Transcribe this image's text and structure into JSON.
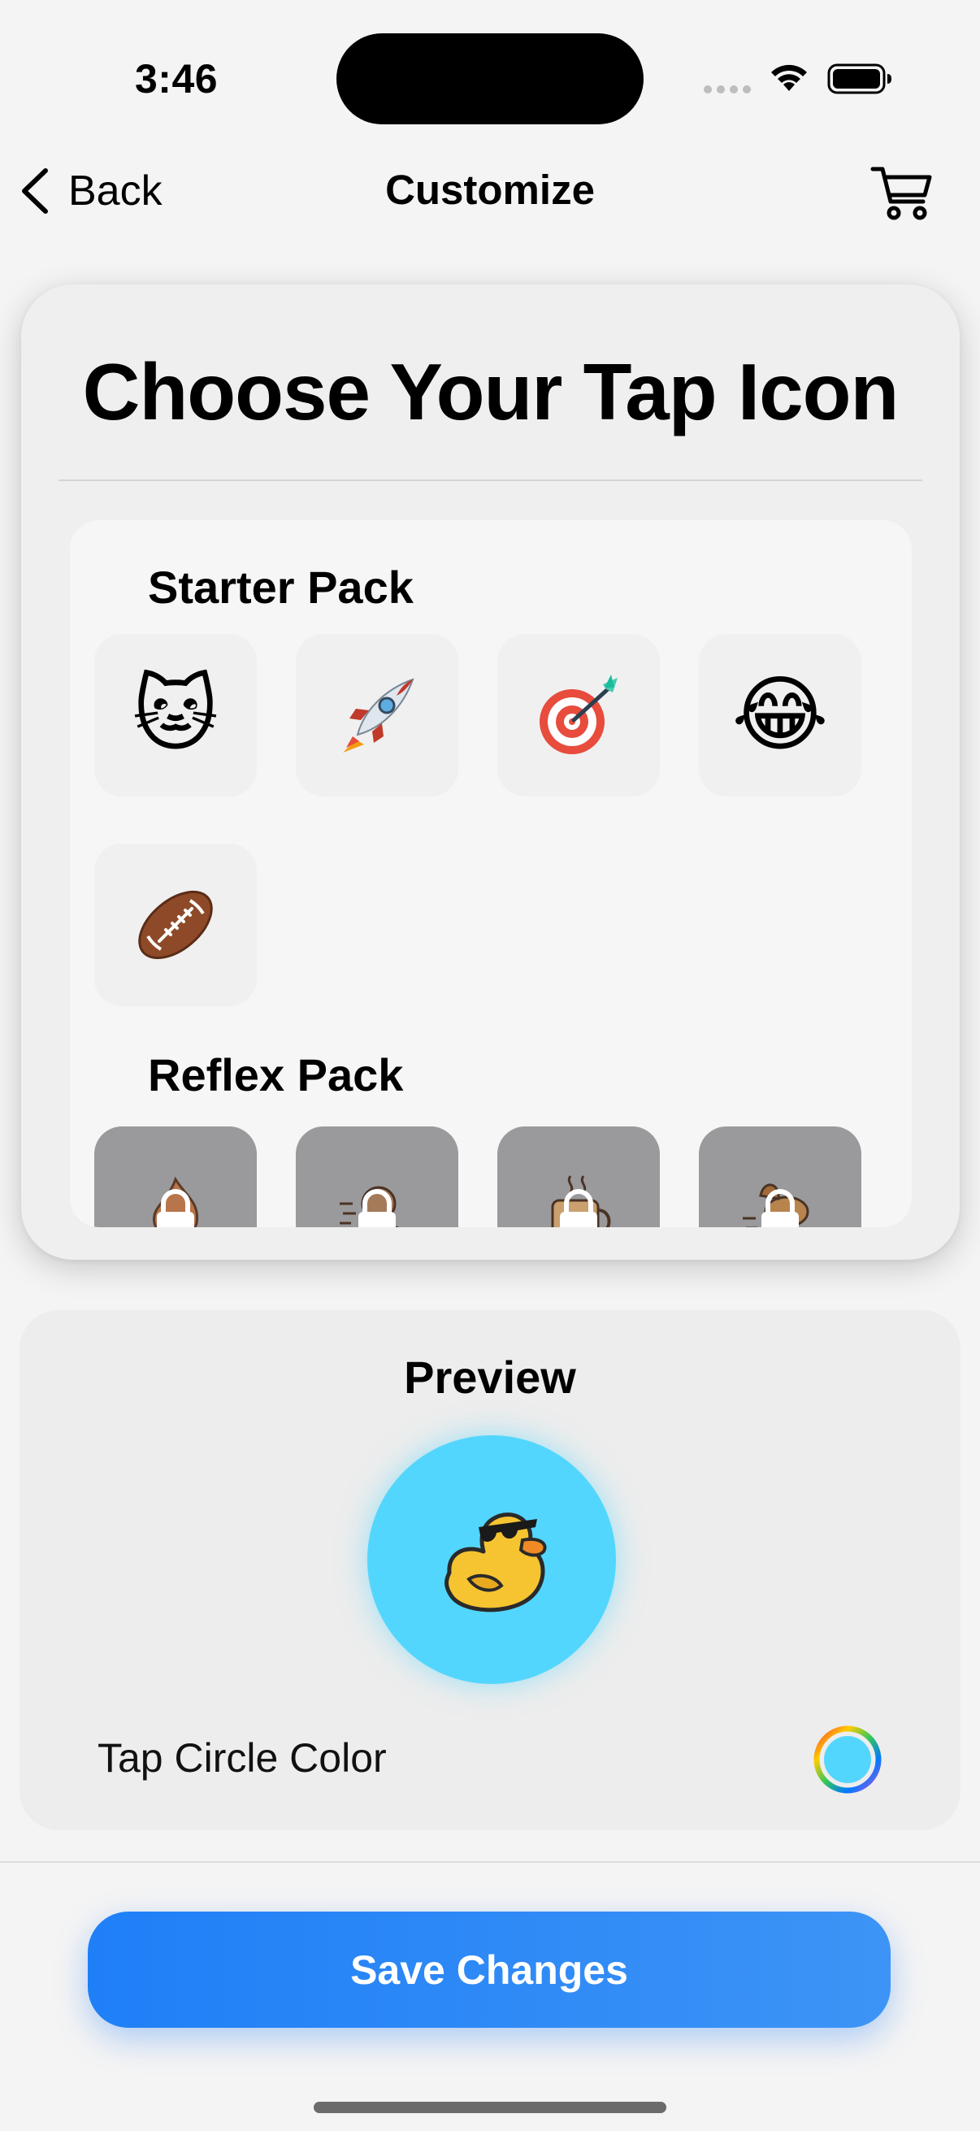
{
  "status_bar": {
    "time": "3:46",
    "icons": [
      "signal-dots-icon",
      "wifi-icon",
      "battery-icon"
    ]
  },
  "nav": {
    "back_label": "Back",
    "title": "Customize",
    "cart_icon": "cart-icon"
  },
  "icon_picker": {
    "title": "Choose Your Tap Icon",
    "packs": [
      {
        "name": "Starter Pack",
        "icons": [
          {
            "emoji": "🐱",
            "name": "cat-face"
          },
          {
            "emoji": "🚀",
            "name": "rocket"
          },
          {
            "emoji": "🎯",
            "name": "direct-hit-target"
          },
          {
            "emoji": "😂",
            "name": "tears-of-joy"
          },
          {
            "emoji": "🏈",
            "name": "american-football"
          }
        ]
      },
      {
        "name": "Reflex Pack",
        "locked": true,
        "icons": [
          {
            "name": "flame-character",
            "locked": true
          },
          {
            "name": "sloth-racer",
            "locked": true
          },
          {
            "name": "coffee-mug",
            "locked": true
          },
          {
            "name": "running-dog",
            "locked": true
          }
        ]
      }
    ]
  },
  "preview": {
    "title": "Preview",
    "icon": "cool-duck-with-sunglasses",
    "circle_color": "#53d6fd",
    "color_label": "Tap Circle Color"
  },
  "actions": {
    "save_label": "Save Changes",
    "accent_color": "#2a86f6"
  }
}
